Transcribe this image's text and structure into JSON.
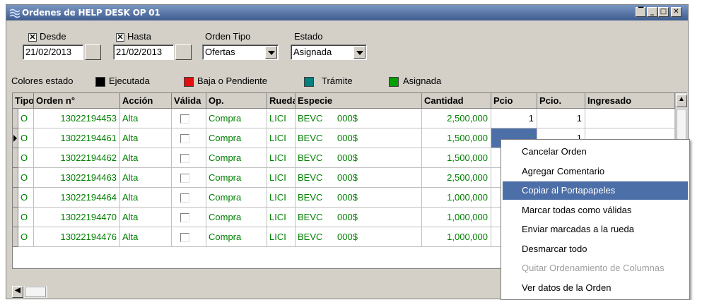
{
  "window": {
    "title": "Ordenes de HELP DESK OP 01",
    "controls": [
      "restore",
      "minimize",
      "maximize",
      "close"
    ]
  },
  "filters": {
    "desde": {
      "label": "Desde",
      "checked": true,
      "value": "21/02/2013"
    },
    "hasta": {
      "label": "Hasta",
      "checked": true,
      "value": "21/02/2013"
    },
    "orden_tipo": {
      "label": "Orden Tipo",
      "value": "Ofertas"
    },
    "estado": {
      "label": "Estado",
      "value": "Asignada"
    }
  },
  "legend": {
    "label": "Colores estado",
    "items": [
      {
        "label": "Ejecutada",
        "color": "#000000"
      },
      {
        "label": "Baja o Pendiente",
        "color": "#e01010"
      },
      {
        "label": "Trámite",
        "color": "#008080"
      },
      {
        "label": "Asignada",
        "color": "#00a000"
      }
    ]
  },
  "table": {
    "columns": [
      "Tipo",
      "Orden n°",
      "Acción",
      "Válida",
      "Op.",
      "Rueda",
      "Especie",
      "Cantidad",
      "Pcio",
      "Pcio.",
      "Ingresado"
    ],
    "rows": [
      {
        "tipo": "O",
        "orden": "13022194453",
        "accion": "Alta",
        "valida": false,
        "op": "Compra",
        "rueda": "LICI",
        "especie": "BEVC",
        "moneda": "000$",
        "cantidad": "2,500,000",
        "pcio": "1",
        "pcio2": "1"
      },
      {
        "tipo": "O",
        "orden": "13022194461",
        "accion": "Alta",
        "valida": false,
        "op": "Compra",
        "rueda": "LICI",
        "especie": "BEVC",
        "moneda": "000$",
        "cantidad": "1,500,000",
        "pcio": "1",
        "pcio2": "1",
        "current": true
      },
      {
        "tipo": "O",
        "orden": "13022194462",
        "accion": "Alta",
        "valida": false,
        "op": "Compra",
        "rueda": "LICI",
        "especie": "BEVC",
        "moneda": "000$",
        "cantidad": "1,500,000",
        "pcio": "",
        "pcio2": ""
      },
      {
        "tipo": "O",
        "orden": "13022194463",
        "accion": "Alta",
        "valida": false,
        "op": "Compra",
        "rueda": "LICI",
        "especie": "BEVC",
        "moneda": "000$",
        "cantidad": "2,500,000",
        "pcio": "",
        "pcio2": ""
      },
      {
        "tipo": "O",
        "orden": "13022194464",
        "accion": "Alta",
        "valida": false,
        "op": "Compra",
        "rueda": "LICI",
        "especie": "BEVC",
        "moneda": "000$",
        "cantidad": "1,000,000",
        "pcio": "",
        "pcio2": ""
      },
      {
        "tipo": "O",
        "orden": "13022194470",
        "accion": "Alta",
        "valida": false,
        "op": "Compra",
        "rueda": "LICI",
        "especie": "BEVC",
        "moneda": "000$",
        "cantidad": "1,000,000",
        "pcio": "",
        "pcio2": ""
      },
      {
        "tipo": "O",
        "orden": "13022194476",
        "accion": "Alta",
        "valida": false,
        "op": "Compra",
        "rueda": "LICI",
        "especie": "BEVC",
        "moneda": "000$",
        "cantidad": "1,000,000",
        "pcio": "",
        "pcio2": ""
      }
    ]
  },
  "context_menu": {
    "items": [
      {
        "label": "Cancelar Orden",
        "state": "normal"
      },
      {
        "label": "Agregar Comentario",
        "state": "normal"
      },
      {
        "label": "Copiar al Portapapeles",
        "state": "selected"
      },
      {
        "label": "Marcar todas como válidas",
        "state": "normal"
      },
      {
        "label": "Enviar marcadas a la rueda",
        "state": "normal"
      },
      {
        "label": "Desmarcar todo",
        "state": "normal"
      },
      {
        "label": "Quitar Ordenamiento de Columnas",
        "state": "disabled"
      },
      {
        "label": "Ver datos de la Orden",
        "state": "normal"
      }
    ]
  },
  "colors": {
    "row_text": "#008000",
    "selection": "#4d6fa8"
  }
}
